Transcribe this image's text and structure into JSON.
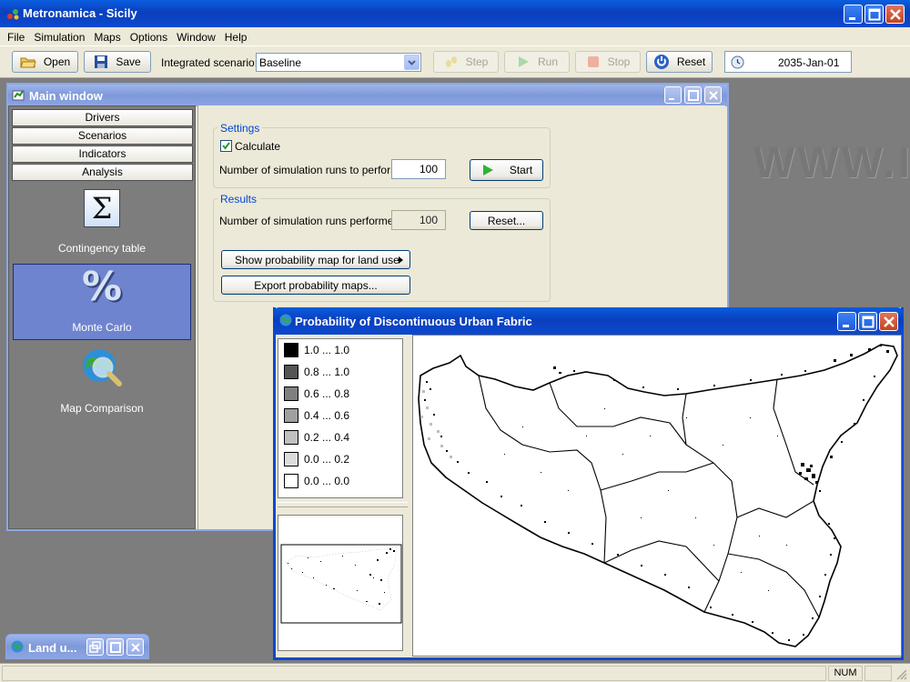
{
  "app": {
    "title": "Metronamica - Sicily"
  },
  "menu": [
    "File",
    "Simulation",
    "Maps",
    "Options",
    "Window",
    "Help"
  ],
  "toolbar": {
    "open": "Open",
    "save": "Save",
    "scenario_label": "Integrated scenario:",
    "scenario_value": "Baseline",
    "step": "Step",
    "run": "Run",
    "stop": "Stop",
    "reset": "Reset",
    "date": "2035-Jan-01"
  },
  "bg_watermark": "WWW.I",
  "main_window": {
    "title": "Main window",
    "tabs": [
      "Drivers",
      "Scenarios",
      "Indicators",
      "Analysis"
    ],
    "tools": [
      {
        "label": "Contingency table",
        "icon": "sigma-icon"
      },
      {
        "label": "Monte Carlo",
        "icon": "percent-icon"
      },
      {
        "label": "Map Comparison",
        "icon": "globe-magnifier-icon"
      }
    ],
    "settings": {
      "group_label": "Settings",
      "calculate_label": "Calculate",
      "calculate_checked": true,
      "runs_label": "Number of simulation runs to perform:",
      "runs_value": "100",
      "start": "Start"
    },
    "results": {
      "group_label": "Results",
      "performed_label": "Number of simulation runs performed:",
      "performed_value": "100",
      "reset": "Reset...",
      "show_map": "Show probability map for land use",
      "export": "Export probability maps..."
    }
  },
  "prob_window": {
    "title": "Probability of Discontinuous Urban Fabric",
    "legend": [
      {
        "label": "1.0 ... 1.0",
        "color": "#000000"
      },
      {
        "label": "0.8 ... 1.0",
        "color": "#555555"
      },
      {
        "label": "0.6 ... 0.8",
        "color": "#808080"
      },
      {
        "label": "0.4 ... 0.6",
        "color": "#a0a0a0"
      },
      {
        "label": "0.2 ... 0.4",
        "color": "#c0c0c0"
      },
      {
        "label": "0.0 ... 0.2",
        "color": "#dcdcdc"
      },
      {
        "label": "0.0 ... 0.0",
        "color": "#ffffff"
      }
    ]
  },
  "minimized": {
    "title": "Land u..."
  },
  "status": {
    "num": "NUM"
  }
}
